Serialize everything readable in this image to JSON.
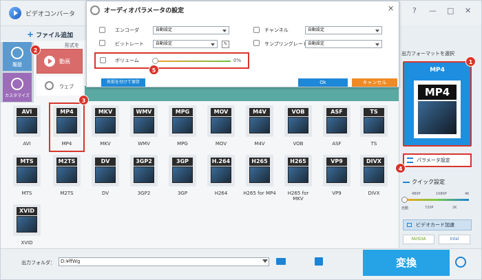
{
  "app": {
    "title": "ビデオコンバータ",
    "add_file": "ファイル追加",
    "controls": [
      "?",
      "—",
      "□",
      "✕"
    ]
  },
  "sidebar": {
    "history": "履歴",
    "customize": "カスタマイズ"
  },
  "categories": {
    "video": "動画",
    "web": "ウェブ",
    "shape_hint": "形式を"
  },
  "formats": [
    {
      "tag": "AVI",
      "label": "AVI"
    },
    {
      "tag": "MP4",
      "label": "MP4"
    },
    {
      "tag": "MKV",
      "label": "MKV"
    },
    {
      "tag": "WMV",
      "label": "WMV"
    },
    {
      "tag": "MPG",
      "label": "MPG"
    },
    {
      "tag": "MOV",
      "label": "MOV"
    },
    {
      "tag": "M4V",
      "label": "M4V"
    },
    {
      "tag": "VOB",
      "label": "VOB"
    },
    {
      "tag": "ASF",
      "label": "ASF"
    },
    {
      "tag": "TS",
      "label": "TS"
    },
    {
      "tag": "MTS",
      "label": "MTS"
    },
    {
      "tag": "M2TS",
      "label": "M2TS"
    },
    {
      "tag": "DV",
      "label": "DV"
    },
    {
      "tag": "3GP2",
      "label": "3GP2"
    },
    {
      "tag": "3GP",
      "label": "3GP"
    },
    {
      "tag": "H.264",
      "label": "H264"
    },
    {
      "tag": "H265",
      "label": "H265 for MP4"
    },
    {
      "tag": "H265",
      "label": "H265 for MKV"
    },
    {
      "tag": "VP9",
      "label": "VP9"
    },
    {
      "tag": "DIVX",
      "label": "DIVX"
    },
    {
      "tag": "XVID",
      "label": "XVID"
    }
  ],
  "output": {
    "label": "出力フォルダ：",
    "path": "D:¥ffWg"
  },
  "convert": "変換",
  "right_panel": {
    "title": "出力フォーマットを選択",
    "format": "MP4",
    "format_tag": "MP4",
    "param_button": "パラメータ設定",
    "quick": "クイック設定",
    "quick_top": [
      "480P",
      "1080P",
      "4K"
    ],
    "quick_bottom": [
      "自動",
      "720P",
      "2K"
    ],
    "gpu": "ビデオカード加速",
    "nvidia": "NVIDIA",
    "intel": "Intel"
  },
  "dialog": {
    "title": "オーディオパラメータの設定",
    "close": "✕",
    "encoder_label": "エンコーダ",
    "encoder_value": "自動設定",
    "bitrate_label": "ビットレート",
    "bitrate_value": "自動設定",
    "channel_label": "チャンネル",
    "channel_value": "自動設定",
    "samplerate_label": "サンプリングレート",
    "samplerate_value": "自動設定",
    "volume_label": "ボリューム",
    "volume_value": "0%",
    "save_button": "名前を付けて保存",
    "ok_button": "Ok",
    "cancel_button": "キャンセル"
  },
  "badges": [
    "1",
    "2",
    "3",
    "4",
    "5"
  ]
}
